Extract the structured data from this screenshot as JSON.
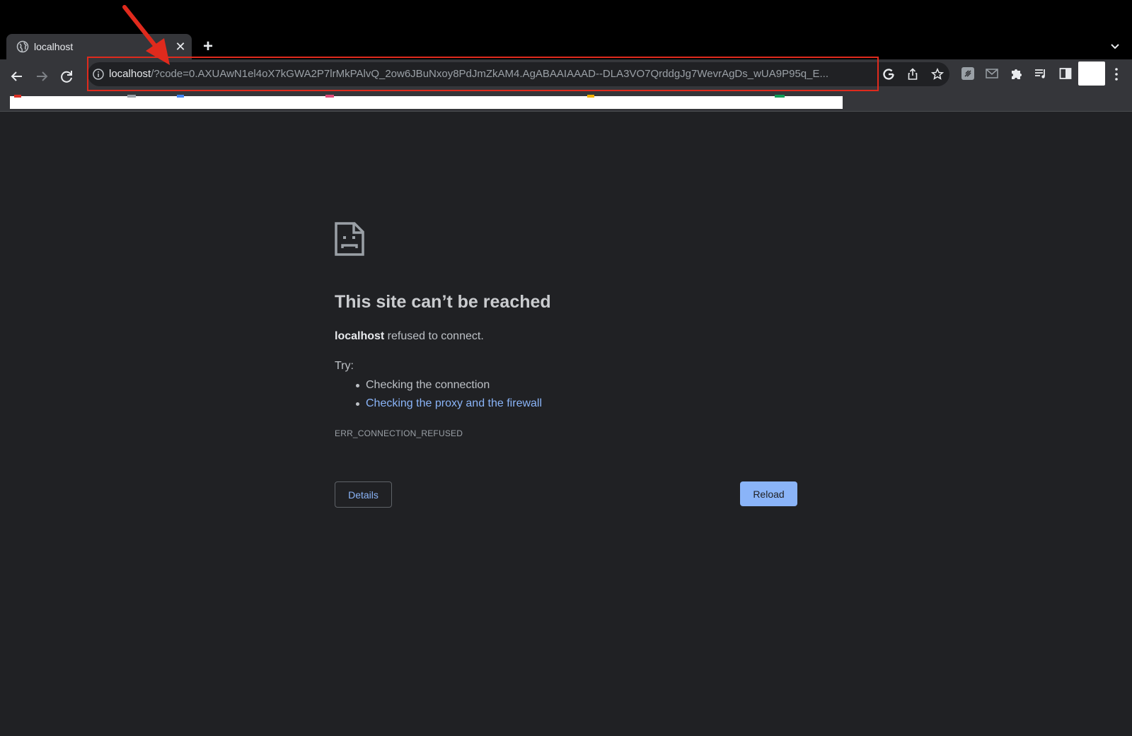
{
  "browser": {
    "tab": {
      "title": "localhost",
      "favicon": "globe-icon",
      "close_icon": "close-icon"
    },
    "new_tab_icon": "plus-icon",
    "tab_search_icon": "chevron-down-icon",
    "toolbar": {
      "back_icon": "back-arrow-icon",
      "forward_icon": "forward-arrow-icon",
      "reload_icon": "reload-icon",
      "site_info_icon": "info-icon",
      "url_host": "localhost",
      "url_rest": "/?code=0.AXUAwN1el4oX7kGWA2P7lrMkPAlvQ_2ow6JBuNxoy8PdJmZkAM4.AgABAAIAAAD--DLA3VO7QrddgJg7WevrAgDs_wUA9P95q_E...",
      "omnibox_icons": [
        "google-lens-icon",
        "share-icon",
        "bookmark-star-icon"
      ],
      "extension_icons": [
        "extension-app-icon",
        "mail-icon",
        "puzzle-icon",
        "media-queue-icon",
        "side-panel-icon"
      ],
      "menu_icon": "kebab-menu-icon"
    }
  },
  "annotation": {
    "arrow_color": "#e02a1d",
    "box_color": "#e02a1d"
  },
  "error_page": {
    "icon": "sad-document-icon",
    "title": "This site can’t be reached",
    "host": "localhost",
    "description_rest": " refused to connect.",
    "try_label": "Try:",
    "suggestions": [
      "Checking the connection",
      "Checking the proxy and the firewall"
    ],
    "error_code": "ERR_CONNECTION_REFUSED",
    "details_button": "Details",
    "reload_button": "Reload"
  },
  "colors": {
    "page_background": "#202124",
    "link": "#8ab4f8",
    "primary_button": "#8ab4f8"
  }
}
